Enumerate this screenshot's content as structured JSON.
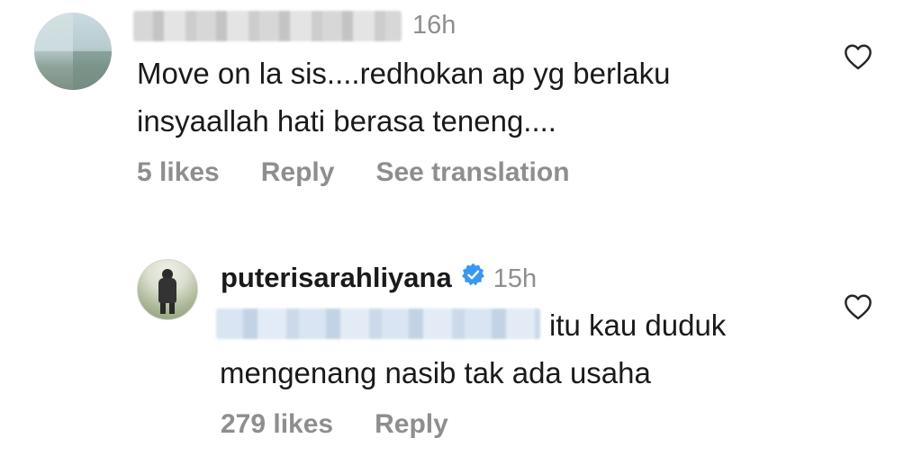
{
  "comments": [
    {
      "time": "16h",
      "line1": "Move on la sis....redhokan ap yg berlaku",
      "line2": "insyaallah hati berasa teneng....",
      "likes": "5 likes",
      "reply": "Reply",
      "translate": "See translation",
      "like_icon": "heart-outline-icon"
    },
    {
      "username": "puterisarahliyana",
      "verified_icon": "verified-badge-icon",
      "time": "15h",
      "line1_after_mention": "itu kau duduk",
      "line2": "mengenang nasib tak ada usaha",
      "likes": "279 likes",
      "reply": "Reply",
      "like_icon": "heart-outline-icon"
    }
  ],
  "colors": {
    "text": "#1a1a1a",
    "secondary": "#8e8e8e",
    "verified": "#3897f0"
  }
}
